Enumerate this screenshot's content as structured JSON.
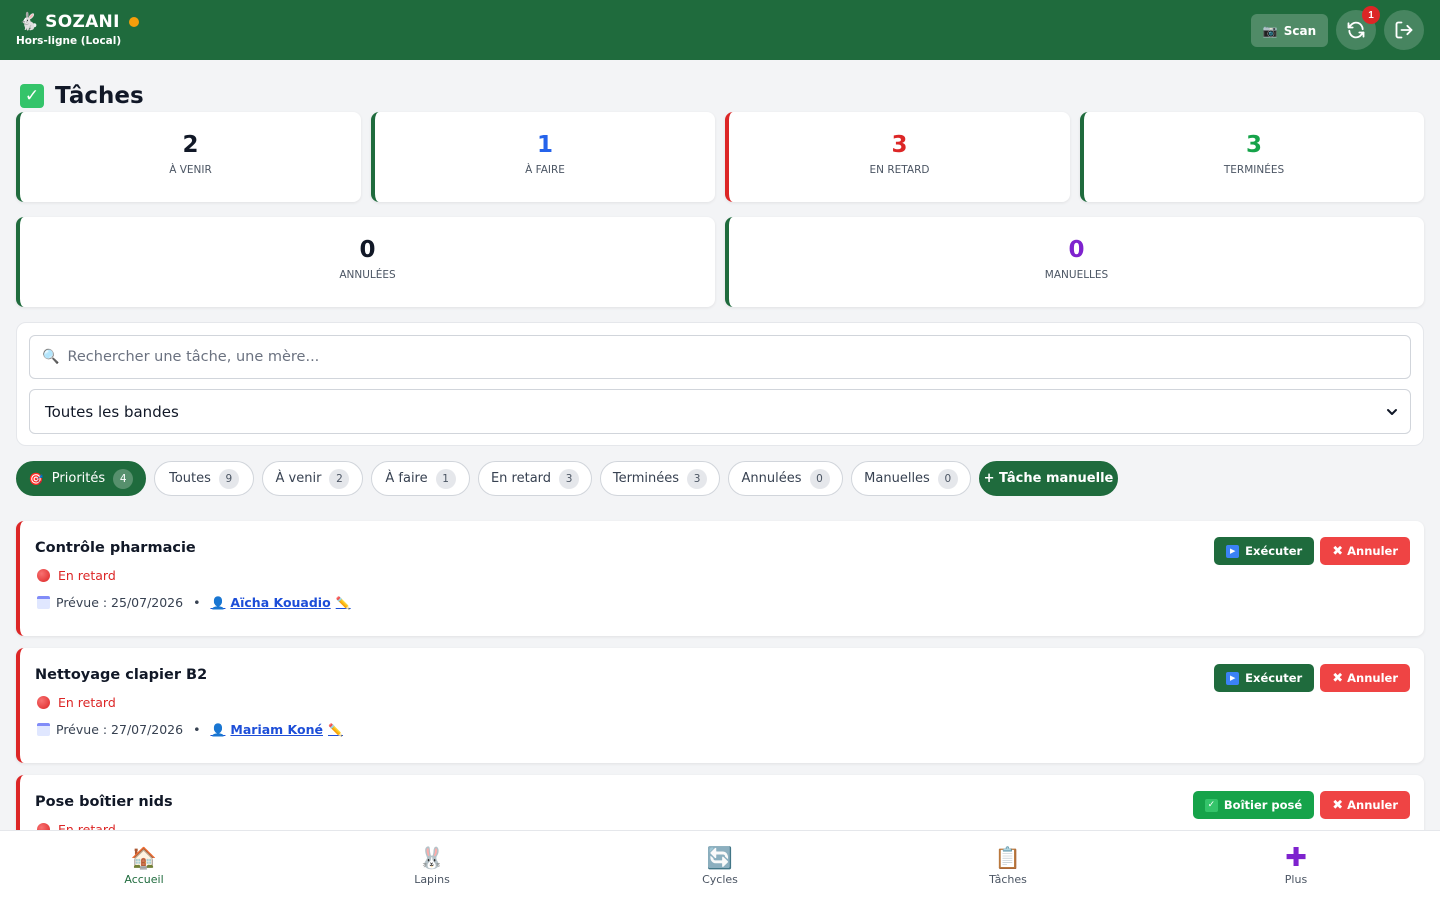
{
  "app": {
    "name": "SOZANI",
    "status_label": "Hors-ligne (Local)",
    "status_color": "#f59e0b",
    "brand_color": "#1f6b3d"
  },
  "header": {
    "scan_label": "Scan",
    "sync_badge": "1",
    "icons": [
      "rabbit-logo-icon",
      "camera-icon",
      "sync-icon",
      "logout-icon"
    ]
  },
  "page": {
    "title": "Tâches"
  },
  "stats": [
    {
      "value": "2",
      "label": "À VENIR",
      "color": "#111827"
    },
    {
      "value": "1",
      "label": "À FAIRE",
      "color": "#2563eb"
    },
    {
      "value": "3",
      "label": "EN RETARD",
      "color": "#dc2626"
    },
    {
      "value": "3",
      "label": "TERMINÉES",
      "color": "#16a34a"
    },
    {
      "value": "0",
      "label": "ANNULÉES",
      "color": "#111827"
    },
    {
      "value": "0",
      "label": "MANUELLES",
      "color": "#7e22ce"
    }
  ],
  "search": {
    "placeholder": "Rechercher une tâche, une mère..."
  },
  "band_filter": {
    "selected": "Toutes les bandes"
  },
  "filters": [
    {
      "label": "Priorités",
      "count": "4",
      "active": true
    },
    {
      "label": "Toutes",
      "count": "9"
    },
    {
      "label": "À venir",
      "count": "2"
    },
    {
      "label": "À faire",
      "count": "1"
    },
    {
      "label": "En retard",
      "count": "3"
    },
    {
      "label": "Terminées",
      "count": "3"
    },
    {
      "label": "Annulées",
      "count": "0"
    },
    {
      "label": "Manuelles",
      "count": "0"
    }
  ],
  "manual_task_label": "+ Tâche manuelle",
  "tasks": [
    {
      "title": "Contrôle pharmacie",
      "status": "En retard",
      "due": "Prévue : 25/07/2026",
      "separator": "•",
      "assignee": "Aïcha Kouadio",
      "primary_action": "Exécuter",
      "cancel_action": "Annuler"
    },
    {
      "title": "Nettoyage clapier B2",
      "status": "En retard",
      "due": "Prévue : 27/07/2026",
      "separator": "•",
      "assignee": "Mariam Koné",
      "primary_action": "Exécuter",
      "cancel_action": "Annuler"
    },
    {
      "title": "Pose boîtier nids",
      "status": "En retard",
      "primary_action": "Boîtier posé",
      "cancel_action": "Annuler"
    }
  ],
  "bottom_nav": [
    {
      "label": "Accueil",
      "icon": "house-icon",
      "active": true
    },
    {
      "label": "Lapins",
      "icon": "rabbit-icon"
    },
    {
      "label": "Cycles",
      "icon": "cycle-icon"
    },
    {
      "label": "Tâches",
      "icon": "clipboard-icon"
    },
    {
      "label": "Plus",
      "icon": "plus-icon"
    }
  ]
}
